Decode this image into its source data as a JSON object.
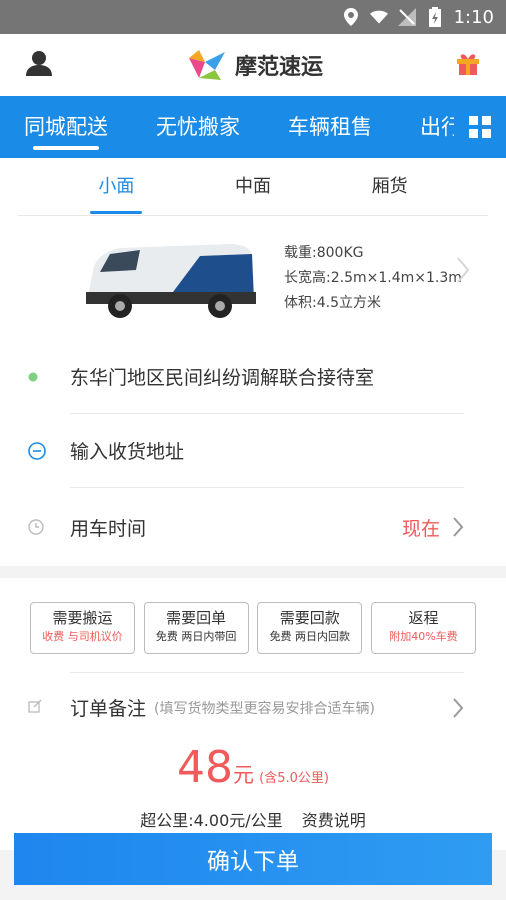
{
  "status": {
    "time": "1:10"
  },
  "header": {
    "app_name": "摩范速运"
  },
  "tabs": [
    {
      "label": "同城配送"
    },
    {
      "label": "无忧搬家"
    },
    {
      "label": "车辆租售"
    },
    {
      "label": "出行"
    }
  ],
  "size_tabs": [
    {
      "label": "小面"
    },
    {
      "label": "中面"
    },
    {
      "label": "厢货"
    }
  ],
  "vehicle": {
    "load": "载重:800KG",
    "dims": "长宽高:2.5m×1.4m×1.3m",
    "volume": "体积:4.5立方米"
  },
  "address": {
    "pickup": "东华门地区民间纠纷调解联合接待室",
    "dropoff_placeholder": "输入收货地址"
  },
  "time_row": {
    "label": "用车时间",
    "value": "现在"
  },
  "services": [
    {
      "title": "需要搬运",
      "sub": "收费 与司机议价",
      "sub_color": "#f05a5a"
    },
    {
      "title": "需要回单",
      "sub": "免费 两日内带回",
      "sub_color": "#333333"
    },
    {
      "title": "需要回款",
      "sub": "免费 两日内回款",
      "sub_color": "#333333"
    },
    {
      "title": "返程",
      "sub": "附加40%车费",
      "sub_color": "#f05a5a"
    }
  ],
  "remark": {
    "label": "订单备注",
    "hint": "(填写货物类型更容易安排合适车辆)"
  },
  "price": {
    "amount": "48",
    "unit": "元",
    "included": "(含5.0公里)",
    "extra": "超公里:4.00元/公里",
    "fee_desc": "资费说明"
  },
  "confirm_label": "确认下单",
  "colors": {
    "brand": "#1a8be6",
    "price": "#f05a5a"
  }
}
